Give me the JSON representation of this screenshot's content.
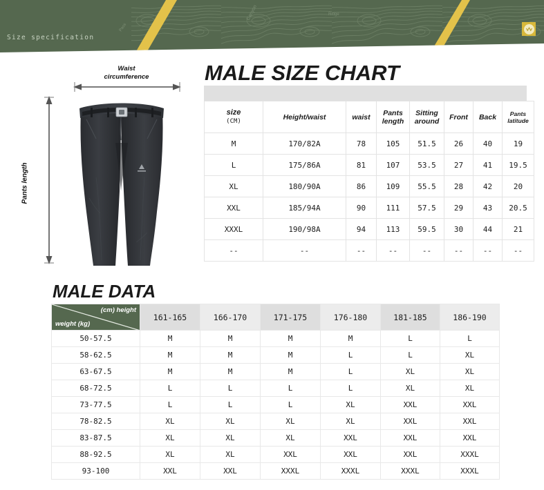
{
  "banner": {
    "label": "Size specification",
    "bg_color": "#55684f",
    "stripe_color": "#e3c24a",
    "badge_color": "#d8b83a"
  },
  "diagram": {
    "waist_label_line1": "Waist",
    "waist_label_line2": "circumference",
    "length_label": "Pants length",
    "alt": "dark grey hiking pants front view"
  },
  "size_chart": {
    "title": "MALE SIZE CHART",
    "columns": [
      {
        "label": "size",
        "sub": "(CM)"
      },
      {
        "label": "Height/waist",
        "sub": ""
      },
      {
        "label": "waist",
        "sub": ""
      },
      {
        "label": "Pants length",
        "sub": ""
      },
      {
        "label": "Sitting around",
        "sub": ""
      },
      {
        "label": "Front",
        "sub": ""
      },
      {
        "label": "Back",
        "sub": ""
      },
      {
        "label": "Pants latitude",
        "sub": ""
      }
    ],
    "rows": [
      [
        "M",
        "170/82A",
        "78",
        "105",
        "51.5",
        "26",
        "40",
        "19"
      ],
      [
        "L",
        "175/86A",
        "81",
        "107",
        "53.5",
        "27",
        "41",
        "19.5"
      ],
      [
        "XL",
        "180/90A",
        "86",
        "109",
        "55.5",
        "28",
        "42",
        "20"
      ],
      [
        "XXL",
        "185/94A",
        "90",
        "111",
        "57.5",
        "29",
        "43",
        "20.5"
      ],
      [
        "XXXL",
        "190/98A",
        "94",
        "113",
        "59.5",
        "30",
        "44",
        "21"
      ],
      [
        "--",
        "--",
        "--",
        "--",
        "--",
        "--",
        "--",
        "--"
      ]
    ]
  },
  "male_data": {
    "title": "MALE  DATA",
    "corner_top": "(cm) height",
    "corner_bottom": "weight (kg)",
    "height_ranges": [
      "161-165",
      "166-170",
      "171-175",
      "176-180",
      "181-185",
      "186-190"
    ],
    "rows": [
      {
        "weight": "50-57.5",
        "sizes": [
          "M",
          "M",
          "M",
          "M",
          "L",
          "L"
        ]
      },
      {
        "weight": "58-62.5",
        "sizes": [
          "M",
          "M",
          "M",
          "L",
          "L",
          "XL"
        ]
      },
      {
        "weight": "63-67.5",
        "sizes": [
          "M",
          "M",
          "M",
          "L",
          "XL",
          "XL"
        ]
      },
      {
        "weight": "68-72.5",
        "sizes": [
          "L",
          "L",
          "L",
          "L",
          "XL",
          "XL"
        ]
      },
      {
        "weight": "73-77.5",
        "sizes": [
          "L",
          "L",
          "L",
          "XL",
          "XXL",
          "XXL"
        ]
      },
      {
        "weight": "78-82.5",
        "sizes": [
          "XL",
          "XL",
          "XL",
          "XL",
          "XXL",
          "XXL"
        ]
      },
      {
        "weight": "83-87.5",
        "sizes": [
          "XL",
          "XL",
          "XL",
          "XXL",
          "XXL",
          "XXL"
        ]
      },
      {
        "weight": "88-92.5",
        "sizes": [
          "XL",
          "XL",
          "XXL",
          "XXL",
          "XXL",
          "XXXL"
        ]
      },
      {
        "weight": "93-100",
        "sizes": [
          "XXL",
          "XXL",
          "XXXL",
          "XXXL",
          "XXXL",
          "XXXL"
        ]
      }
    ]
  }
}
